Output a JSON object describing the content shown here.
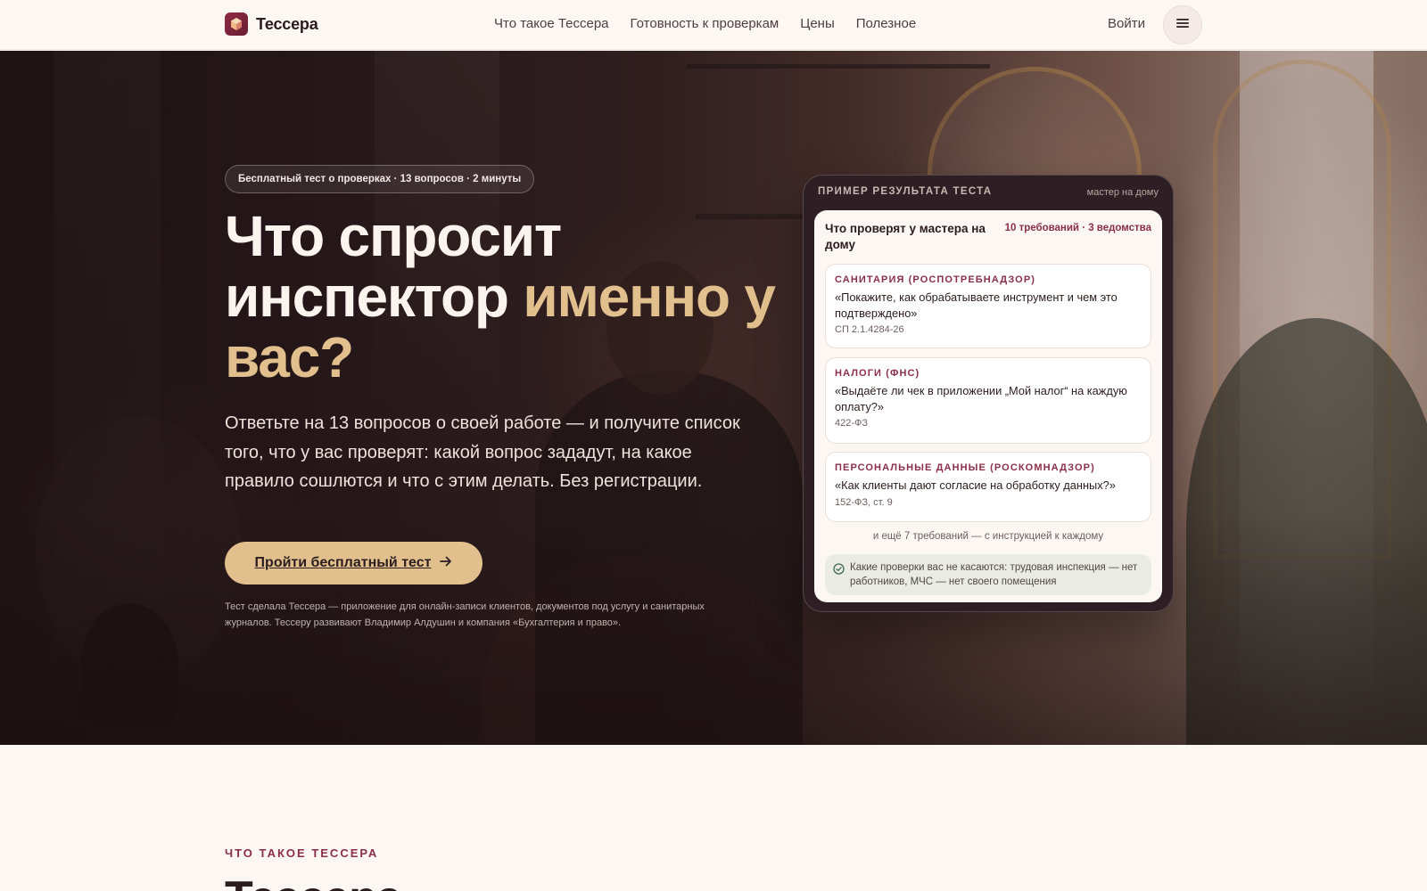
{
  "brand": {
    "name": "Тессера"
  },
  "nav": {
    "items": [
      "Что такое Тессера",
      "Готовность к проверкам",
      "Цены",
      "Полезное"
    ],
    "login": "Войти"
  },
  "hero": {
    "pill": "Бесплатный тест о проверках · 13 вопросов · 2 минуты",
    "headline_part1": "Что спросит инспектор ",
    "headline_accent": "именно у вас?",
    "lead": "Ответьте на 13 вопросов о своей работе — и получите список того, что у вас проверят: какой вопрос зададут, на какое правило сошлются и что с этим делать. Без регистрации.",
    "cta": "Пройти бесплатный тест",
    "footnote": "Тест сделала Тессера — приложение для онлайн-записи клиентов, документов под услугу и санитарных журналов. Тессеру развивают Владимир Алдушин и компания «Бухгалтерия и право»."
  },
  "result_card": {
    "label": "Пример результата теста",
    "profile": "мастер на дому",
    "title": "Что проверят у мастера на дому",
    "meta": "10 требований · 3 ведомства",
    "requirements": [
      {
        "category": "Санитария (Роспотребнадзор)",
        "question": "«Покажите, как обрабатываете инструмент и чем это подтверждено»",
        "law": "СП 2.1.4284-26"
      },
      {
        "category": "Налоги (ФНС)",
        "question": "«Выдаёте ли чек в приложении „Мой налог“ на каждую оплату?»",
        "law": "422-ФЗ"
      },
      {
        "category": "Персональные данные (Роскомнадзор)",
        "question": "«Как клиенты дают согласие на обработку данных?»",
        "law": "152-ФЗ, ст. 9"
      }
    ],
    "more": "и ещё 7 требований — с инструкцией к каждому",
    "note": "Какие проверки вас не касаются: трудовая инспекция — нет работников, МЧС — нет своего помещения"
  },
  "section": {
    "eyebrow": "ЧТО ТАКОЕ ТЕССЕРА",
    "title": "Тессера"
  },
  "colors": {
    "accent_gold": "#e2c08d",
    "brand_burgundy": "#8a2f49",
    "background": "#fdf7f3"
  },
  "icons": [
    "logo-mark-icon",
    "hamburger-menu-icon",
    "arrow-right-icon",
    "check-circle-icon"
  ]
}
